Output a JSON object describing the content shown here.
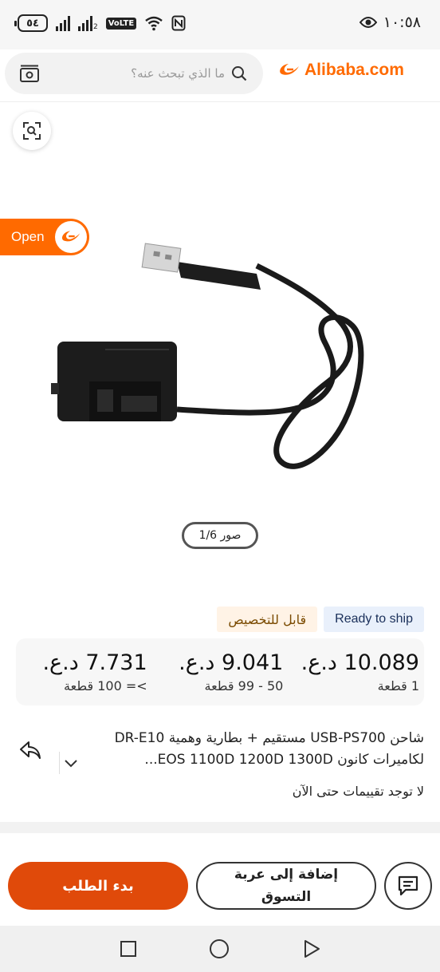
{
  "status_bar": {
    "time": "١٠:٥٨",
    "battery": "٥٤",
    "volte": "VoLTE",
    "sim2": "2"
  },
  "header": {
    "logo_text": "Alibaba.com",
    "search_placeholder": "ما الذي تبحث عنه؟"
  },
  "gallery": {
    "open_label": "Open",
    "counter": "صور 1/6"
  },
  "tags": {
    "ship": "Ready to ship",
    "customizable": "قابل للتخصيص"
  },
  "price_tiers": [
    {
      "price": "10.089 د.ع.",
      "qty": "1 قطعة"
    },
    {
      "price": "9.041 د.ع.",
      "qty": "50 - 99 قطعة"
    },
    {
      "price": "7.731 د.ع.",
      "qty": ">= 100 قطعة"
    }
  ],
  "product": {
    "title": "شاحن USB-PS700 مستقيم + بطارية وهمية DR-E10 لكاميرات كانون EOS 1100D 1200D 1300D...",
    "reviews": "لا توجد تقييمات حتى الآن"
  },
  "actions": {
    "order": "بدء الطلب",
    "cart": "إضافة إلى عربة التسوق"
  },
  "colors": {
    "brand": "#ff6a00",
    "order_button": "#e04a0a"
  }
}
